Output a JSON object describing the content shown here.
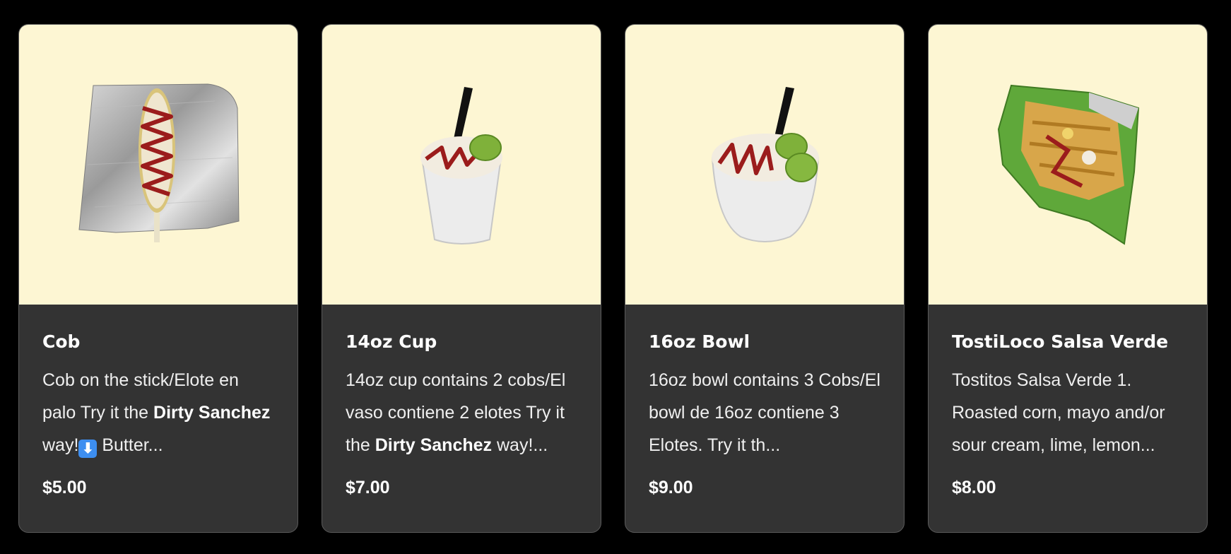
{
  "products": [
    {
      "title": "Cob",
      "desc_parts": [
        "Cob on the stick/Elote en palo Try it the ",
        "Dirty Sanchez",
        " way!",
        " Butter..."
      ],
      "price": "$5.00",
      "image_icon": "elote-cob-foil-icon"
    },
    {
      "title": "14oz Cup",
      "desc_parts": [
        "14oz cup contains 2 cobs/El vaso contiene 2 elotes Try it the ",
        "Dirty Sanchez",
        " way!..."
      ],
      "price": "$7.00",
      "image_icon": "esquites-cup-icon"
    },
    {
      "title": "16oz Bowl",
      "desc": "16oz bowl contains 3 Cobs/El bowl de 16oz contiene 3 Elotes. Try it th...",
      "price": "$9.00",
      "image_icon": "esquites-bowl-icon"
    },
    {
      "title": "TostiLoco Salsa Verde",
      "desc": "Tostitos Salsa Verde 1. Roasted corn, mayo and/or sour cream, lime, lemon...",
      "price": "$8.00",
      "image_icon": "tostiloco-bag-icon"
    }
  ],
  "colors": {
    "page_background": "#000000",
    "image_background": "#fdf6d3",
    "card_background": "#333333",
    "text": "#ffffff"
  }
}
